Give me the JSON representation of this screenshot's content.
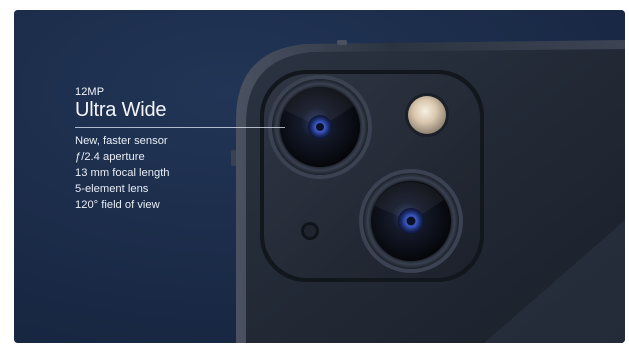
{
  "spec": {
    "eyebrow": "12MP",
    "title": "Ultra Wide",
    "features": [
      "New, faster sensor",
      "ƒ/2.4 aperture",
      "13 mm focal length",
      "5-element lens",
      "120° field of view"
    ]
  },
  "colors": {
    "background": "#1a2a45",
    "device_body": "#1f2634",
    "text": "#f2f5fa"
  }
}
